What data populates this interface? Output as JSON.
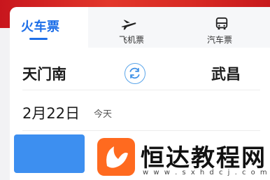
{
  "tabs": [
    {
      "label": "火车票",
      "icon": "train-icon",
      "active": true
    },
    {
      "label": "飞机票",
      "icon": "airplane-icon",
      "active": false
    },
    {
      "label": "汽车票",
      "icon": "bus-icon",
      "active": false
    }
  ],
  "route": {
    "from": "天门南",
    "to": "武昌",
    "swap_icon": "swap-icon"
  },
  "date": {
    "value": "2月22日",
    "weekday": "今天"
  },
  "search_button": {
    "label": ""
  },
  "watermark": {
    "text": "恒达教程网",
    "url": "w w w . s x h d c j . c o m"
  },
  "colors": {
    "accent": "#1e6fe8",
    "header_red": "#d82a24",
    "button_blue": "#3d8ff0",
    "watermark_orange": "#ff6a1f"
  }
}
